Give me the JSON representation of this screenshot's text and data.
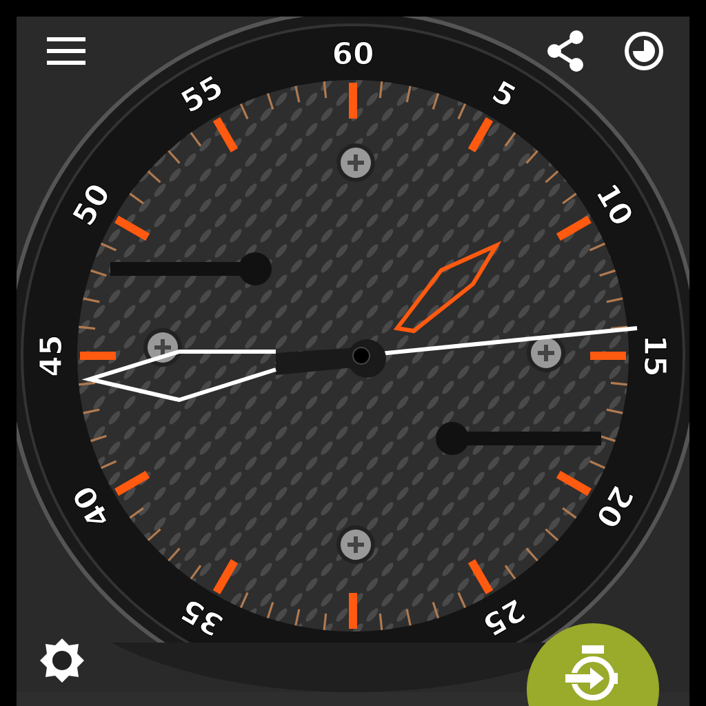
{
  "toolbar": {
    "buttons": [
      {
        "kind": "menu"
      },
      {
        "kind": "share"
      },
      {
        "kind": "theme"
      }
    ]
  },
  "dial": {
    "numbers": [
      "60",
      "5",
      "10",
      "15",
      "20",
      "25",
      "35",
      "40",
      "45",
      "50",
      "55"
    ]
  },
  "bottom": {
    "buttons": [
      {
        "kind": "settings"
      },
      {
        "kind": "apply"
      }
    ]
  }
}
